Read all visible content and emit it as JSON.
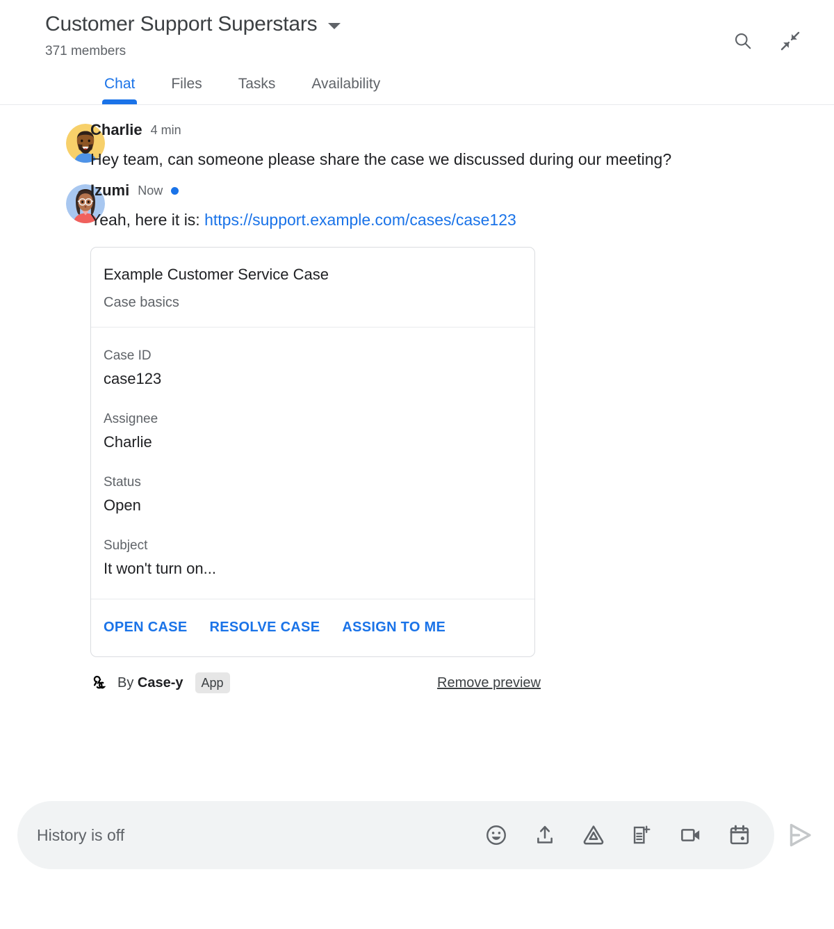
{
  "header": {
    "room_title": "Customer Support Superstars",
    "member_count": "371 members",
    "dropdown_icon": "chevron-down-icon",
    "search_icon": "search-icon",
    "collapse_icon": "collapse-arrows-icon"
  },
  "tabs": [
    {
      "label": "Chat",
      "active": true
    },
    {
      "label": "Files",
      "active": false
    },
    {
      "label": "Tasks",
      "active": false
    },
    {
      "label": "Availability",
      "active": false
    }
  ],
  "messages": [
    {
      "sender": "Charlie",
      "timestamp": "4 min",
      "unread": false,
      "text": "Hey team, can someone please share the case we discussed during our meeting?",
      "avatar": "charlie-avatar"
    },
    {
      "sender": "Izumi",
      "timestamp": "Now",
      "unread": true,
      "text_prefix": "Yeah, here it is: ",
      "link_text": "https://support.example.com/cases/case123",
      "avatar": "izumi-avatar"
    }
  ],
  "card": {
    "title": "Example Customer Service Case",
    "subtitle": "Case basics",
    "fields": [
      {
        "label": "Case ID",
        "value": "case123"
      },
      {
        "label": "Assignee",
        "value": "Charlie"
      },
      {
        "label": "Status",
        "value": "Open"
      },
      {
        "label": "Subject",
        "value": "It won't turn on..."
      }
    ],
    "actions": [
      {
        "label": "OPEN CASE"
      },
      {
        "label": "RESOLVE CASE"
      },
      {
        "label": "ASSIGN TO ME"
      }
    ]
  },
  "attribution": {
    "icon": "webhook-icon",
    "by_text": "By ",
    "app_name": "Case-y",
    "app_badge": "App",
    "remove_preview": "Remove preview"
  },
  "compose": {
    "placeholder": "History is off",
    "value": "",
    "icons": [
      {
        "name": "emoji-icon"
      },
      {
        "name": "upload-icon"
      },
      {
        "name": "google-drive-icon"
      },
      {
        "name": "create-document-icon"
      },
      {
        "name": "video-meeting-icon"
      },
      {
        "name": "calendar-icon"
      }
    ],
    "send_icon": "send-icon"
  },
  "colors": {
    "accent": "#1a73e8",
    "text_primary": "#202124",
    "text_secondary": "#5f6368",
    "border": "#dadce0",
    "compose_bg": "#f1f3f4",
    "send_disabled": "#c4c7c9"
  }
}
